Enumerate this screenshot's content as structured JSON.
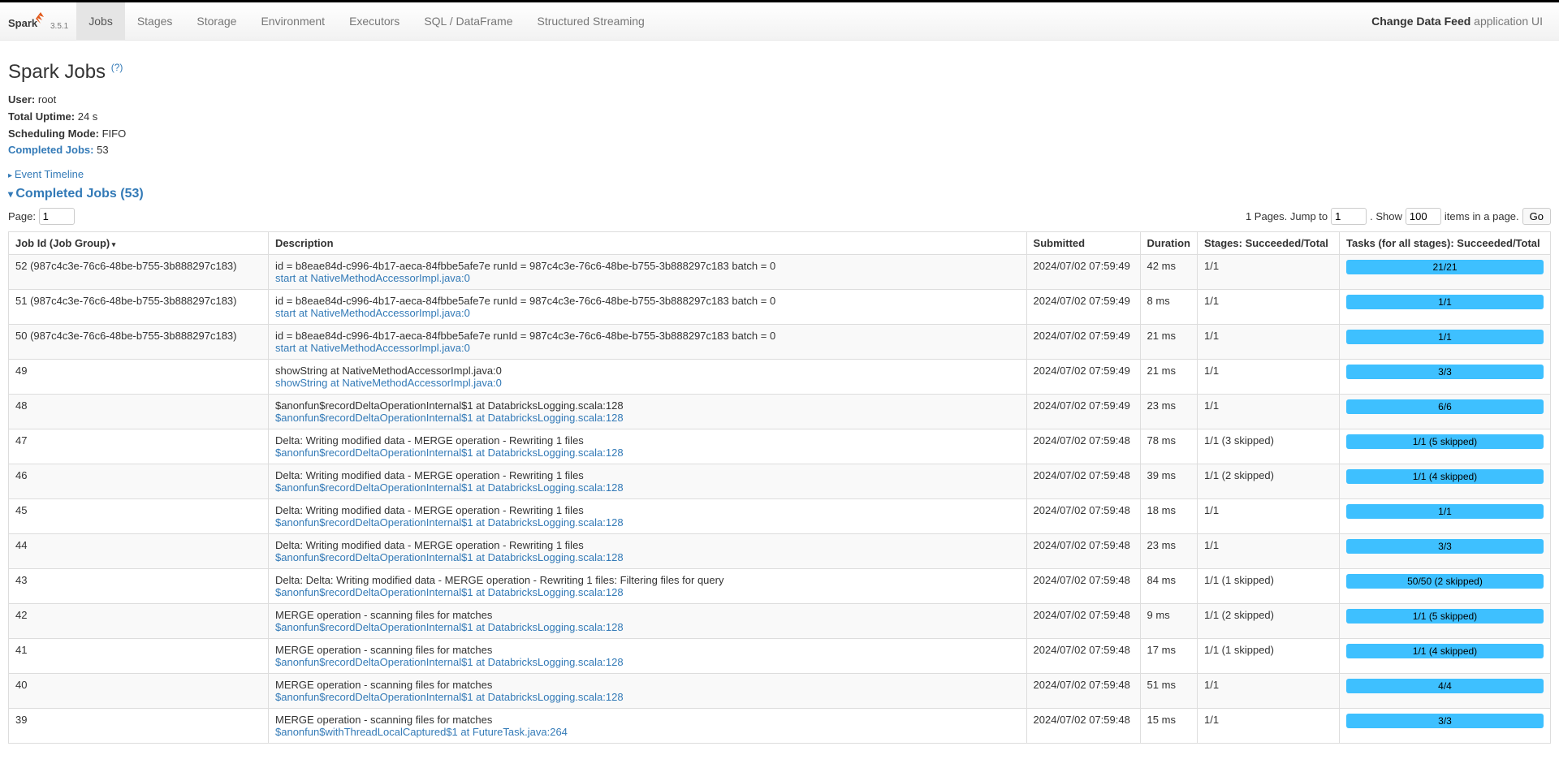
{
  "brand": {
    "version": "3.5.1"
  },
  "nav": {
    "tabs": [
      "Jobs",
      "Stages",
      "Storage",
      "Environment",
      "Executors",
      "SQL / DataFrame",
      "Structured Streaming"
    ],
    "activeIndex": 0,
    "appName": "Change Data Feed",
    "appSuffix": "application UI"
  },
  "page": {
    "title": "Spark Jobs",
    "helpMark": "(?)"
  },
  "summary": {
    "userLabel": "User:",
    "user": "root",
    "uptimeLabel": "Total Uptime:",
    "uptime": "24 s",
    "schedLabel": "Scheduling Mode:",
    "sched": "FIFO",
    "completedLabel": "Completed Jobs:",
    "completed": "53"
  },
  "eventTimeline": "Event Timeline",
  "completedHeader": "Completed Jobs (53)",
  "pagination": {
    "pageLabel": "Page:",
    "page": "1",
    "pagesLabelPrefix": "1 Pages. Jump to",
    "jumpTo": "1",
    "showLabel": ". Show",
    "items": "100",
    "itemsSuffix": "items in a page.",
    "go": "Go"
  },
  "columns": {
    "jobId": "Job Id (Job Group)",
    "description": "Description",
    "submitted": "Submitted",
    "duration": "Duration",
    "stages": "Stages: Succeeded/Total",
    "tasks": "Tasks (for all stages): Succeeded/Total"
  },
  "rows": [
    {
      "jobId": "52 (987c4c3e-76c6-48be-b755-3b888297c183)",
      "desc": "id = b8eae84d-c996-4b17-aeca-84fbbe5afe7e runId = 987c4c3e-76c6-48be-b755-3b888297c183 batch = 0",
      "link": "start at NativeMethodAccessorImpl.java:0",
      "submitted": "2024/07/02 07:59:49",
      "duration": "42 ms",
      "stages": "1/1",
      "tasks": "21/21"
    },
    {
      "jobId": "51 (987c4c3e-76c6-48be-b755-3b888297c183)",
      "desc": "id = b8eae84d-c996-4b17-aeca-84fbbe5afe7e runId = 987c4c3e-76c6-48be-b755-3b888297c183 batch = 0",
      "link": "start at NativeMethodAccessorImpl.java:0",
      "submitted": "2024/07/02 07:59:49",
      "duration": "8 ms",
      "stages": "1/1",
      "tasks": "1/1"
    },
    {
      "jobId": "50 (987c4c3e-76c6-48be-b755-3b888297c183)",
      "desc": "id = b8eae84d-c996-4b17-aeca-84fbbe5afe7e runId = 987c4c3e-76c6-48be-b755-3b888297c183 batch = 0",
      "link": "start at NativeMethodAccessorImpl.java:0",
      "submitted": "2024/07/02 07:59:49",
      "duration": "21 ms",
      "stages": "1/1",
      "tasks": "1/1"
    },
    {
      "jobId": "49",
      "desc": "showString at NativeMethodAccessorImpl.java:0",
      "link": "showString at NativeMethodAccessorImpl.java:0",
      "submitted": "2024/07/02 07:59:49",
      "duration": "21 ms",
      "stages": "1/1",
      "tasks": "3/3"
    },
    {
      "jobId": "48",
      "desc": "$anonfun$recordDeltaOperationInternal$1 at DatabricksLogging.scala:128",
      "link": "$anonfun$recordDeltaOperationInternal$1 at DatabricksLogging.scala:128",
      "submitted": "2024/07/02 07:59:49",
      "duration": "23 ms",
      "stages": "1/1",
      "tasks": "6/6"
    },
    {
      "jobId": "47",
      "desc": "Delta: Writing modified data - MERGE operation - Rewriting 1 files",
      "link": "$anonfun$recordDeltaOperationInternal$1 at DatabricksLogging.scala:128",
      "submitted": "2024/07/02 07:59:48",
      "duration": "78 ms",
      "stages": "1/1 (3 skipped)",
      "tasks": "1/1 (5 skipped)"
    },
    {
      "jobId": "46",
      "desc": "Delta: Writing modified data - MERGE operation - Rewriting 1 files",
      "link": "$anonfun$recordDeltaOperationInternal$1 at DatabricksLogging.scala:128",
      "submitted": "2024/07/02 07:59:48",
      "duration": "39 ms",
      "stages": "1/1 (2 skipped)",
      "tasks": "1/1 (4 skipped)"
    },
    {
      "jobId": "45",
      "desc": "Delta: Writing modified data - MERGE operation - Rewriting 1 files",
      "link": "$anonfun$recordDeltaOperationInternal$1 at DatabricksLogging.scala:128",
      "submitted": "2024/07/02 07:59:48",
      "duration": "18 ms",
      "stages": "1/1",
      "tasks": "1/1"
    },
    {
      "jobId": "44",
      "desc": "Delta: Writing modified data - MERGE operation - Rewriting 1 files",
      "link": "$anonfun$recordDeltaOperationInternal$1 at DatabricksLogging.scala:128",
      "submitted": "2024/07/02 07:59:48",
      "duration": "23 ms",
      "stages": "1/1",
      "tasks": "3/3"
    },
    {
      "jobId": "43",
      "desc": "Delta: Delta: Writing modified data - MERGE operation - Rewriting 1 files: Filtering files for query",
      "link": "$anonfun$recordDeltaOperationInternal$1 at DatabricksLogging.scala:128",
      "submitted": "2024/07/02 07:59:48",
      "duration": "84 ms",
      "stages": "1/1 (1 skipped)",
      "tasks": "50/50 (2 skipped)"
    },
    {
      "jobId": "42",
      "desc": "MERGE operation - scanning files for matches",
      "link": "$anonfun$recordDeltaOperationInternal$1 at DatabricksLogging.scala:128",
      "submitted": "2024/07/02 07:59:48",
      "duration": "9 ms",
      "stages": "1/1 (2 skipped)",
      "tasks": "1/1 (5 skipped)"
    },
    {
      "jobId": "41",
      "desc": "MERGE operation - scanning files for matches",
      "link": "$anonfun$recordDeltaOperationInternal$1 at DatabricksLogging.scala:128",
      "submitted": "2024/07/02 07:59:48",
      "duration": "17 ms",
      "stages": "1/1 (1 skipped)",
      "tasks": "1/1 (4 skipped)"
    },
    {
      "jobId": "40",
      "desc": "MERGE operation - scanning files for matches",
      "link": "$anonfun$recordDeltaOperationInternal$1 at DatabricksLogging.scala:128",
      "submitted": "2024/07/02 07:59:48",
      "duration": "51 ms",
      "stages": "1/1",
      "tasks": "4/4"
    },
    {
      "jobId": "39",
      "desc": "MERGE operation - scanning files for matches",
      "link": "$anonfun$withThreadLocalCaptured$1 at FutureTask.java:264",
      "submitted": "2024/07/02 07:59:48",
      "duration": "15 ms",
      "stages": "1/1",
      "tasks": "3/3"
    }
  ]
}
